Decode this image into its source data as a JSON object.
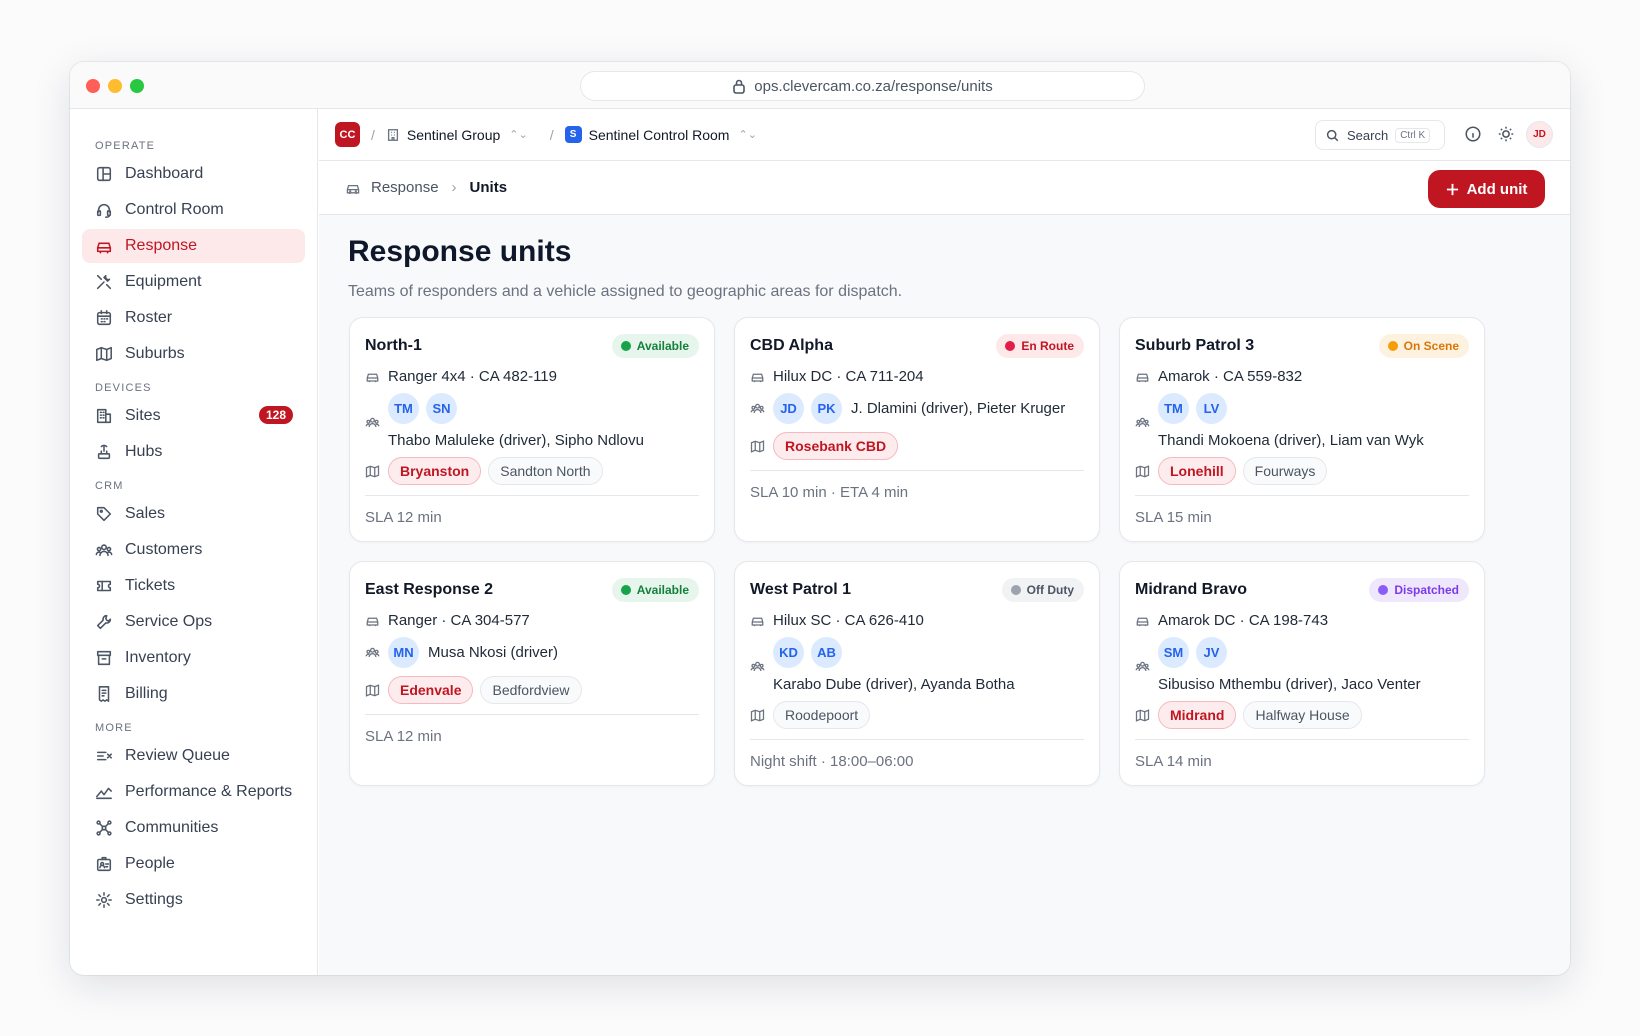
{
  "browser": {
    "url": "ops.clevercam.co.za/response/units"
  },
  "sidebar": {
    "sections": [
      {
        "title": "OPERATE",
        "items": [
          {
            "label": "Dashboard",
            "icon": "dashboard-icon"
          },
          {
            "label": "Control Room",
            "icon": "headset-icon"
          },
          {
            "label": "Response",
            "icon": "car-icon",
            "active": true
          },
          {
            "label": "Equipment",
            "icon": "tools-icon"
          },
          {
            "label": "Roster",
            "icon": "calendar-icon"
          },
          {
            "label": "Suburbs",
            "icon": "map-icon"
          }
        ]
      },
      {
        "title": "DEVICES",
        "items": [
          {
            "label": "Sites",
            "icon": "building-icon",
            "badge": "128"
          },
          {
            "label": "Hubs",
            "icon": "hub-icon"
          }
        ]
      },
      {
        "title": "CRM",
        "items": [
          {
            "label": "Sales",
            "icon": "tag-icon"
          },
          {
            "label": "Customers",
            "icon": "users-icon"
          },
          {
            "label": "Tickets",
            "icon": "ticket-icon"
          },
          {
            "label": "Service Ops",
            "icon": "wrench-icon"
          },
          {
            "label": "Inventory",
            "icon": "archive-icon"
          },
          {
            "label": "Billing",
            "icon": "receipt-icon"
          }
        ]
      },
      {
        "title": "MORE",
        "items": [
          {
            "label": "Review Queue",
            "icon": "review-icon"
          },
          {
            "label": "Performance & Reports",
            "icon": "chart-line-icon"
          },
          {
            "label": "Communities",
            "icon": "network-icon"
          },
          {
            "label": "People",
            "icon": "id-card-icon"
          },
          {
            "label": "Settings",
            "icon": "gear-icon"
          }
        ]
      }
    ]
  },
  "topbar": {
    "logo": "CC",
    "org": "Sentinel Group",
    "room_badge": "S",
    "room": "Sentinel Control Room",
    "search_label": "Search",
    "search_kbd": "Ctrl K",
    "user_initials": "JD"
  },
  "breadcrumb": {
    "parent": "Response",
    "current": "Units"
  },
  "actions": {
    "add_label": "Add unit"
  },
  "page": {
    "title": "Response units",
    "subtitle": "Teams of responders and a vehicle assigned to geographic areas for dispatch."
  },
  "units": [
    {
      "name": "North-1",
      "status": "Available",
      "status_color": "#16a34a",
      "status_bg": "#e7f6ec",
      "status_fg": "#15803d",
      "vehicle": "Ranger 4x4 · CA 482-119",
      "initials": [
        "TM",
        "SN"
      ],
      "crew": "Thabo Maluleke (driver), Sipho Ndlovu",
      "areas": [
        "Bryanston",
        "Sandton North"
      ],
      "footer": "SLA 12 min",
      "inline": false
    },
    {
      "name": "CBD Alpha",
      "status": "En Route",
      "status_color": "#e11d48",
      "status_bg": "#fde8ea",
      "status_fg": "#c01622",
      "vehicle": "Hilux DC · CA 711-204",
      "initials": [
        "JD",
        "PK"
      ],
      "crew": "J. Dlamini (driver), Pieter Kruger",
      "areas": [
        "Rosebank CBD"
      ],
      "footer": "SLA 10 min · ETA 4 min",
      "inline": true
    },
    {
      "name": "Suburb Patrol 3",
      "status": "On Scene",
      "status_color": "#f59e0b",
      "status_bg": "#fdf2e0",
      "status_fg": "#d97706",
      "vehicle": "Amarok · CA 559-832",
      "initials": [
        "TM",
        "LV"
      ],
      "crew": "Thandi Mokoena (driver), Liam van Wyk",
      "areas": [
        "Lonehill",
        "Fourways"
      ],
      "footer": "SLA 15 min",
      "inline": false
    },
    {
      "name": "East Response 2",
      "status": "Available",
      "status_color": "#16a34a",
      "status_bg": "#e7f6ec",
      "status_fg": "#15803d",
      "vehicle": "Ranger · CA 304-577",
      "initials": [
        "MN"
      ],
      "crew": "Musa Nkosi (driver)",
      "areas": [
        "Edenvale",
        "Bedfordview"
      ],
      "footer": "SLA 12 min",
      "inline": true
    },
    {
      "name": "West Patrol 1",
      "status": "Off Duty",
      "status_color": "#9ca3af",
      "status_bg": "#f1f2f4",
      "status_fg": "#4b5563",
      "vehicle": "Hilux SC · CA 626-410",
      "initials": [
        "KD",
        "AB"
      ],
      "crew": "Karabo Dube (driver), Ayanda Botha",
      "areas": [
        "Roodepoort"
      ],
      "footer": "Night shift · 18:00–06:00",
      "inline": false,
      "area_plain": true
    },
    {
      "name": "Midrand Bravo",
      "status": "Dispatched",
      "status_color": "#8b5cf6",
      "status_bg": "#efe8fd",
      "status_fg": "#7c3aed",
      "vehicle": "Amarok DC · CA 198-743",
      "initials": [
        "SM",
        "JV"
      ],
      "crew": "Sibusiso Mthembu (driver), Jaco Venter",
      "areas": [
        "Midrand",
        "Halfway House"
      ],
      "footer": "SLA 14 min",
      "inline": false
    }
  ]
}
